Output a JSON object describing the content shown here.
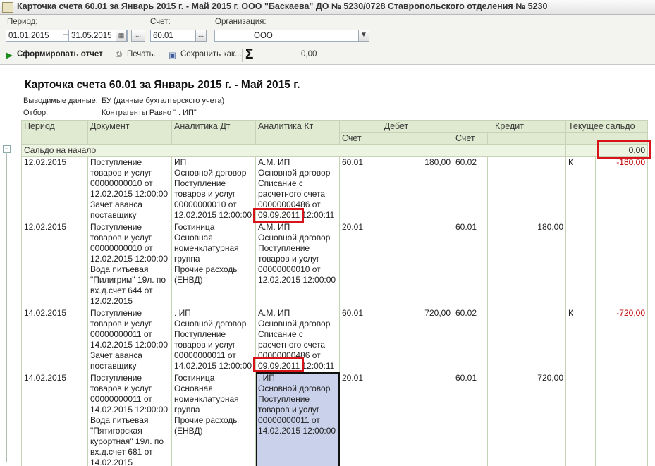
{
  "window": {
    "title": "Карточка счета 60.01 за Январь 2015 г. - Май 2015 г. ООО \"Баскаева\" ДО № 5230/0728 Ставропольского отделения № 5230"
  },
  "params": {
    "period_label": "Период:",
    "date_from": "01.01.2015",
    "date_to": "31.05.2015",
    "period_dots": "...",
    "account_label": "Счет:",
    "account_value": "60.01",
    "account_dots": "...",
    "org_label": "Организация:",
    "org_value": "ООО"
  },
  "toolbar": {
    "generate_label": "Сформировать отчет",
    "print_label": "Печать...",
    "save_label": "Сохранить как...",
    "sum_symbol": "Σ",
    "sum_value": "0,00"
  },
  "report": {
    "title": "Карточка счета 60.01 за Январь 2015 г. - Май 2015 г.",
    "output_label": "Выводимые данные:",
    "output_value": "БУ (данные бухгалтерского учета)",
    "filter_label": "Отбор:",
    "filter_value": "Контрагенты Равно \"                    . ИП\""
  },
  "table": {
    "headers": {
      "period": "Период",
      "document": "Документ",
      "analytics_dt": "Аналитика Дт",
      "analytics_kt": "Аналитика Кт",
      "debit": "Дебет",
      "credit": "Кредит",
      "balance": "Текущее сальдо",
      "account": "Счет"
    },
    "saldo_start": {
      "label": "Сальдо на начало",
      "value": "0,00"
    },
    "rows": [
      {
        "period": "12.02.2015",
        "document": [
          "Поступление",
          "товаров и услуг",
          "00000000010 от",
          "12.02.2015 12:00:00",
          "Зачет аванса",
          "поставщику"
        ],
        "analytics_dt": [
          "             ИП",
          "Основной договор",
          "Поступление",
          "товаров и услуг",
          "00000000010 от",
          "12.02.2015 12:00:00"
        ],
        "analytics_kt": [
          "              А.М. ИП",
          "Основной договор",
          "Списание с",
          "расчетного счета",
          "00000000486 от",
          "09.09.2011 12:00:11"
        ],
        "debit_account": "60.01",
        "debit_amount": "180,00",
        "credit_account": "60.02",
        "credit_amount": "",
        "balance_type": "К",
        "balance_value": "-180,00"
      },
      {
        "period": "12.02.2015",
        "document": [
          "Поступление",
          "товаров и услуг",
          "00000000010 от",
          "12.02.2015 12:00:00",
          "Вода питьевая",
          "\"Пилигрим\" 19л. по",
          "вх.д.счет 644 от",
          "12.02.2015"
        ],
        "analytics_dt": [
          "Гостиница",
          "Основная",
          "номенклатурная",
          "группа",
          "Прочие расходы",
          "(ЕНВД)"
        ],
        "analytics_kt": [
          "              А.М. ИП",
          "Основной договор",
          "Поступление",
          "товаров и услуг",
          "00000000010 от",
          "12.02.2015 12:00:00"
        ],
        "debit_account": "20.01",
        "debit_amount": "",
        "credit_account": "60.01",
        "credit_amount": "180,00",
        "balance_type": "",
        "balance_value": ""
      },
      {
        "period": "14.02.2015",
        "document": [
          "Поступление",
          "товаров и услуг",
          "00000000011 от",
          "14.02.2015 12:00:00",
          "Зачет аванса",
          "поставщику"
        ],
        "analytics_dt": [
          "             . ИП",
          "Основной договор",
          "Поступление",
          "товаров и услуг",
          "00000000011 от",
          "14.02.2015 12:00:00"
        ],
        "analytics_kt": [
          "              А.М. ИП",
          "Основной договор",
          "Списание с",
          "расчетного счета",
          "00000000486 от",
          "09.09.2011 12:00:11"
        ],
        "debit_account": "60.01",
        "debit_amount": "720,00",
        "credit_account": "60.02",
        "credit_amount": "",
        "balance_type": "К",
        "balance_value": "-720,00"
      },
      {
        "period": "14.02.2015",
        "document": [
          "Поступление",
          "товаров и услуг",
          "00000000011 от",
          "14.02.2015 12:00:00",
          "Вода питьевая",
          "\"Пятигорская",
          "курортная\" 19л. по",
          "вх.д.счет 681 от",
          "14.02.2015"
        ],
        "analytics_dt": [
          "Гостиница",
          "Основная",
          "номенклатурная",
          "группа",
          "Прочие расходы",
          "(ЕНВД)"
        ],
        "analytics_kt": [
          "              . ИП",
          "Основной договор",
          "Поступление",
          "товаров и услуг",
          "00000000011 от",
          "14.02.2015 12:00:00"
        ],
        "debit_account": "20.01",
        "debit_amount": "",
        "credit_account": "60.01",
        "credit_amount": "720,00",
        "balance_type": "",
        "balance_value": ""
      }
    ]
  }
}
